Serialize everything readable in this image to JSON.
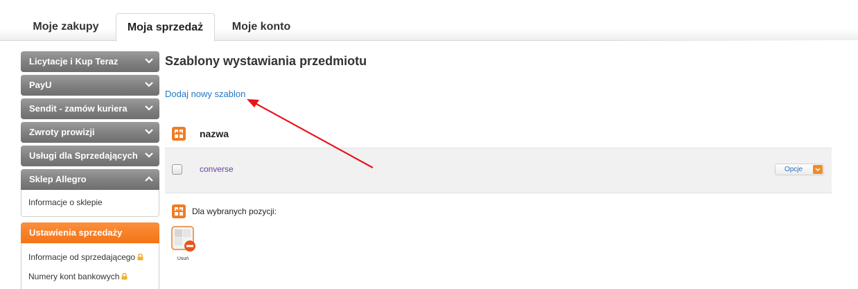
{
  "tabs": [
    {
      "label": "Moje zakupy"
    },
    {
      "label": "Moja sprzedaż"
    },
    {
      "label": "Moje konto"
    }
  ],
  "sidebar": {
    "items": [
      {
        "label": "Licytacje i Kup Teraz"
      },
      {
        "label": "PayU"
      },
      {
        "label": "Sendit - zamów kuriera"
      },
      {
        "label": "Zwroty prowizji"
      },
      {
        "label": "Usługi dla Sprzedających"
      },
      {
        "label": "Sklep Allegro"
      }
    ],
    "shop_links": [
      {
        "label": "Informacje o sklepie"
      }
    ],
    "sales_settings": {
      "label": "Ustawienia sprzedaży",
      "links": [
        {
          "label": "Informacje od sprzedającego"
        },
        {
          "label": "Numery kont bankowych"
        }
      ]
    }
  },
  "main": {
    "title": "Szablony wystawiania przedmiotu",
    "add_link": "Dodaj nowy szablon",
    "column_name": "nazwa",
    "rows": [
      {
        "name": "converse",
        "options_label": "Opcje"
      }
    ],
    "bulk_label": "Dla wybranych pozycji:",
    "delete_label": "Usuń"
  },
  "colors": {
    "accent_orange": "#f47416",
    "link_blue": "#1f77c9",
    "annotation_red": "#e8141b"
  }
}
